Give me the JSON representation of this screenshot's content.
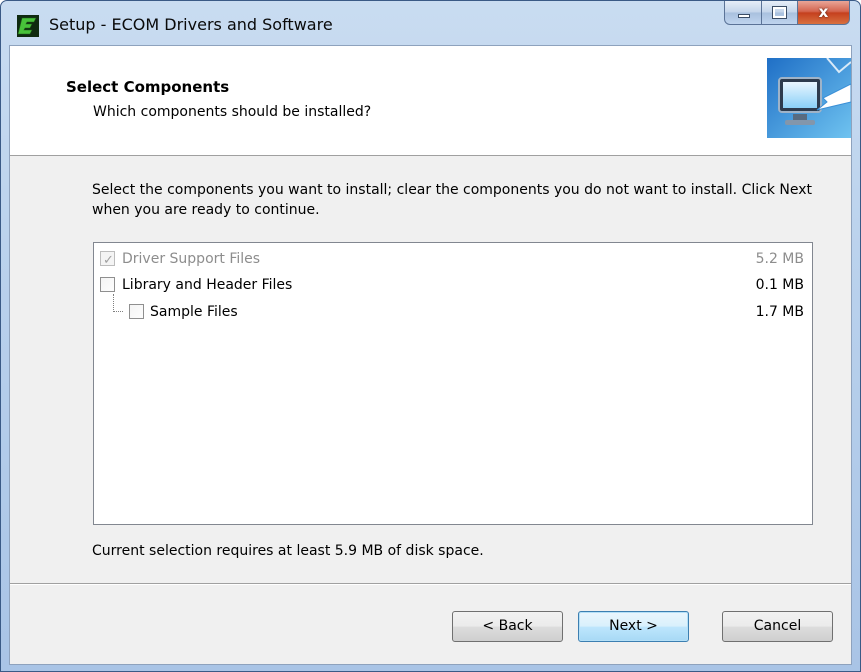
{
  "window": {
    "title": "Setup - ECOM Drivers and Software",
    "close_glyph": "x"
  },
  "header": {
    "title": "Select Components",
    "subtitle": "Which components should be installed?"
  },
  "description": "Select the components you want to install; clear the components you do not want to install. Click Next when you are ready to continue.",
  "components": [
    {
      "label": "Driver Support Files",
      "size": "5.2 MB",
      "checked": true,
      "disabled": true
    },
    {
      "label": "Library and Header Files",
      "size": "0.1 MB",
      "checked": false,
      "disabled": false
    },
    {
      "label": "Sample Files",
      "size": "1.7 MB",
      "checked": false,
      "disabled": false,
      "child": true
    }
  ],
  "disk_space": "Current selection requires at least 5.9 MB of disk space.",
  "buttons": {
    "back": "< Back",
    "next": "Next >",
    "cancel": "Cancel"
  },
  "icons": {
    "app": "ecom-app-icon",
    "wizard": "monitor-arrow-icon",
    "checkmark": "✓"
  }
}
